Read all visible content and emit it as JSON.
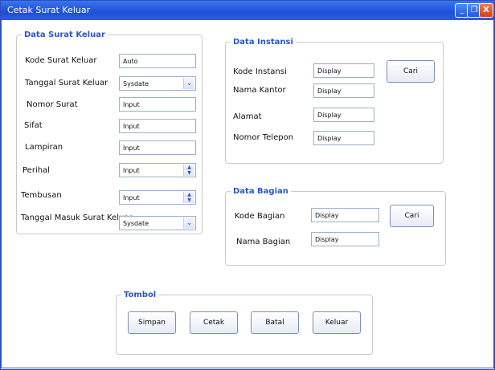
{
  "window": {
    "title": "Cetak Surat Keluar",
    "accent": "#2a5ee6"
  },
  "surat_keluar": {
    "legend": "Data Surat Keluar",
    "kode_label": "Kode Surat Keluar",
    "kode_value": "Auto",
    "tanggal_label": "Tanggal Surat Keluar",
    "tanggal_value": "Sysdate",
    "nomor_label": "Nomor Surat",
    "nomor_value": "Input",
    "sifat_label": "Sifat",
    "sifat_value": "Input",
    "lampiran_label": "Lampiran",
    "lampiran_value": "Input",
    "perihal_label": "Perihal",
    "perihal_value": "Input",
    "tembusan_label": "Tembusan",
    "tembusan_value": "Input",
    "tgl_masuk_label": "Tanggal Masuk Surat Keluar",
    "tgl_masuk_value": "Sysdate"
  },
  "instansi": {
    "legend": "Data Instansi",
    "kode_label": "Kode Instansi",
    "kode_value": "Display",
    "nama_label": "Nama Kantor",
    "nama_value": "Display",
    "alamat_label": "Alamat",
    "alamat_value": "Display",
    "telepon_label": "Nomor Telepon",
    "telepon_value": "Display",
    "cari_label": "Cari"
  },
  "bagian": {
    "legend": "Data Bagian",
    "kode_label": "Kode Bagian",
    "kode_value": "Display",
    "nama_label": "Nama Bagian",
    "nama_value": "Display",
    "cari_label": "Cari"
  },
  "tombol": {
    "legend": "Tombol",
    "simpan": "Simpan",
    "cetak": "Cetak",
    "batal": "Batal",
    "keluar": "Keluar"
  }
}
